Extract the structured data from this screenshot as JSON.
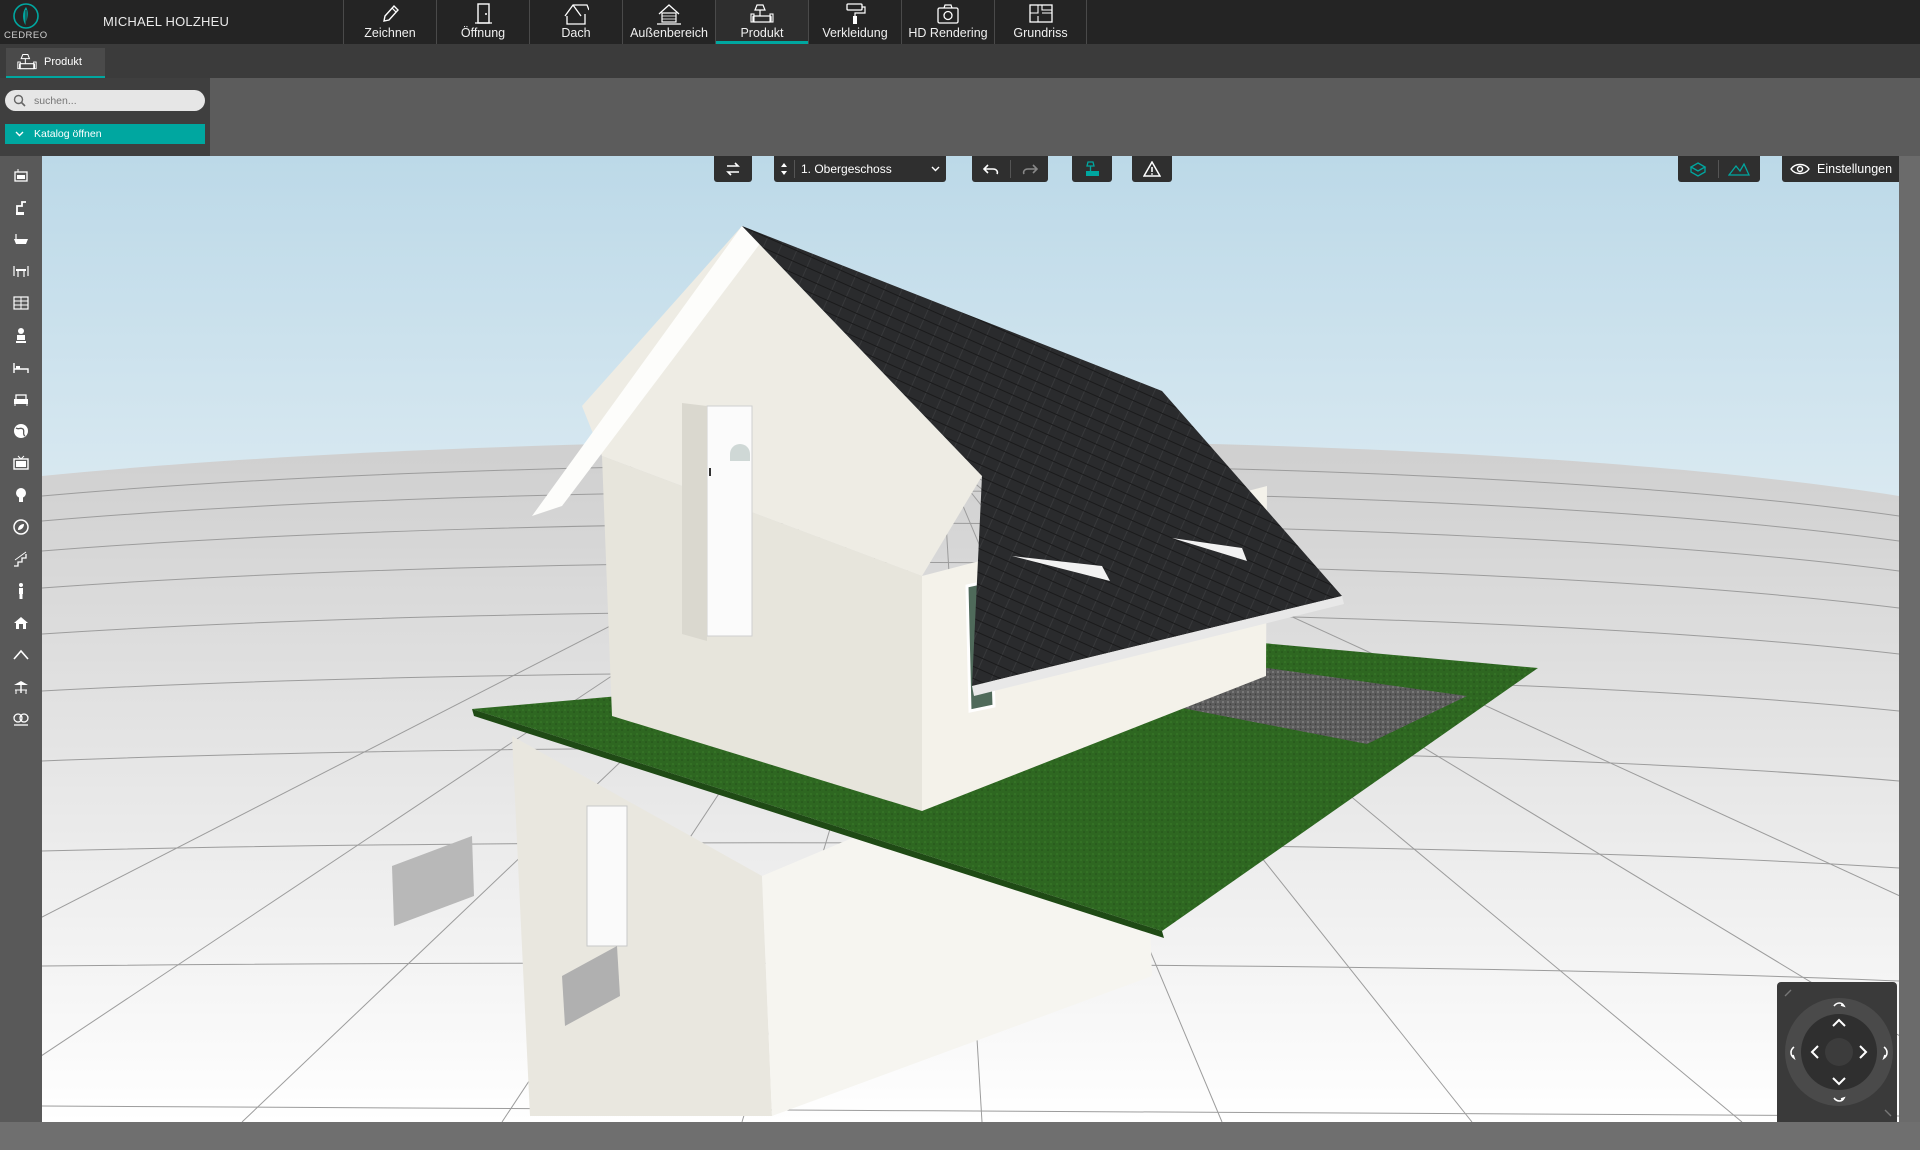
{
  "app": {
    "brand": "CEDREO",
    "user": "MICHAEL HOLZHEU"
  },
  "main_tabs": [
    {
      "id": "zeichnen",
      "label": "Zeichnen",
      "icon": "pencil-icon"
    },
    {
      "id": "oeffnung",
      "label": "Öffnung",
      "icon": "door-icon"
    },
    {
      "id": "dach",
      "label": "Dach",
      "icon": "roof-icon"
    },
    {
      "id": "aussen",
      "label": "Außenbereich",
      "icon": "exterior-house-icon"
    },
    {
      "id": "produkt",
      "label": "Produkt",
      "icon": "sofa-lamp-icon",
      "active": true
    },
    {
      "id": "verkleidung",
      "label": "Verkleidung",
      "icon": "paint-roller-icon"
    },
    {
      "id": "hd",
      "label": "HD Rendering",
      "icon": "camera-icon"
    },
    {
      "id": "grundriss",
      "label": "Grundriss",
      "icon": "floorplan-icon"
    }
  ],
  "sub_tab": {
    "label": "Produkt",
    "icon": "sofa-lamp-icon"
  },
  "search": {
    "placeholder": "suchen..."
  },
  "catalog_button": {
    "label": "Katalog öffnen"
  },
  "category_icons": [
    "kitchen-icon",
    "tap-icon",
    "bathtub-icon",
    "dining-table-icon",
    "shelf-icon",
    "chair-icon",
    "bed-icon",
    "sofa-icon",
    "globe-icon",
    "tv-icon",
    "lightbulb-icon",
    "plant-icon",
    "stairs-icon",
    "person-icon",
    "house-icon",
    "roof-line-icon",
    "pergola-icon",
    "tree-icon"
  ],
  "viewport_toolbar": {
    "floor": "1. Obergeschoss",
    "settings_label": "Einstellungen"
  },
  "colors": {
    "accent": "#00a7a0",
    "topbar": "#242424",
    "roof": "#2c2d2f",
    "grass": "#2f6a22",
    "wall": "#f1efe7"
  }
}
